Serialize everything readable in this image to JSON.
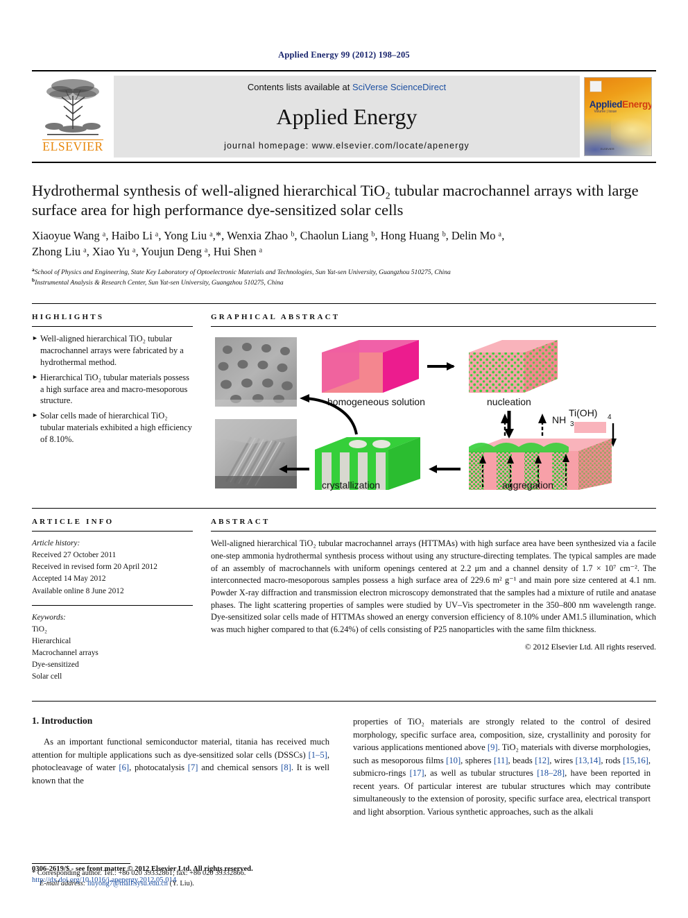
{
  "running_head": "Applied Energy 99 (2012) 198–205",
  "masthead": {
    "publisher": "ELSEVIER",
    "contents_prefix": "Contents lists available at ",
    "contents_link": "SciVerse ScienceDirect",
    "journal_name": "Applied Energy",
    "homepage": "journal homepage: www.elsevier.com/locate/apenergy",
    "cover": {
      "title_a": "Applied",
      "title_b": "Energy",
      "subtitle": "Volume | Issue",
      "footer": "ELSEVIER"
    }
  },
  "article": {
    "title": "Hydrothermal synthesis of well-aligned hierarchical TiO₂ tubular macrochannel arrays with large surface area for high performance dye-sensitized solar cells",
    "authors_line1": "Xiaoyue Wang ᵃ, Haibo Li ᵃ, Yong Liu ᵃ,*, Wenxia Zhao ᵇ, Chaolun Liang ᵇ, Hong Huang ᵇ, Delin Mo ᵃ,",
    "authors_line2": "Zhong Liu ᵃ, Xiao Yu ᵃ, Youjun Deng ᵃ, Hui Shen ᵃ",
    "affiliation_a": "School of Physics and Engineering, State Key Laboratory of Optoelectronic Materials and Technologies, Sun Yat-sen University, Guangzhou 510275, China",
    "affiliation_b": "Instrumental Analysis & Research Center, Sun Yat-sen University, Guangzhou 510275, China"
  },
  "highlights": {
    "heading": "HIGHLIGHTS",
    "items": [
      "Well-aligned hierarchical TiO₂ tubular macrochannel arrays were fabricated by a hydrothermal method.",
      "Hierarchical TiO₂ tubular materials possess a high surface area and macro-mesoporous structure.",
      "Solar cells made of hierarchical TiO₂ tubular materials exhibited a high efficiency of 8.10%."
    ]
  },
  "graphical_abstract": {
    "heading": "GRAPHICAL ABSTRACT",
    "labels": {
      "homogeneous_solution": "homogeneous solution",
      "nucleation": "nucleation",
      "aggregation": "aggregation",
      "crystallization": "crystallization",
      "reagent": "Ti(OH)₄",
      "gas": "NH₃"
    },
    "colors": {
      "magenta": "#ec1c8e",
      "pink": "#f4868f",
      "light_pink": "#f9b3bb",
      "green": "#35cf3a",
      "grey": "#d8d8cf"
    }
  },
  "article_info": {
    "heading": "ARTICLE INFO",
    "history_label": "Article history:",
    "history": [
      "Received 27 October 2011",
      "Received in revised form 20 April 2012",
      "Accepted 14 May 2012",
      "Available online 8 June 2012"
    ],
    "keywords_label": "Keywords:",
    "keywords": [
      "TiO₂",
      "Hierarchical",
      "Macrochannel arrays",
      "Dye-sensitized",
      "Solar cell"
    ]
  },
  "abstract": {
    "heading": "ABSTRACT",
    "text": "Well-aligned hierarchical TiO₂ tubular macrochannel arrays (HTTMAs) with high surface area have been synthesized via a facile one-step ammonia hydrothermal synthesis process without using any structure-directing templates. The typical samples are made of an assembly of macrochannels with uniform openings centered at 2.2 μm and a channel density of 1.7 × 10⁷ cm⁻². The interconnected macro-mesoporous samples possess a high surface area of 229.6 m² g⁻¹ and main pore size centered at 4.1 nm. Powder X-ray diffraction and transmission electron microscopy demonstrated that the samples had a mixture of rutile and anatase phases. The light scattering properties of samples were studied by UV–Vis spectrometer in the 350–800 nm wavelength range. Dye-sensitized solar cells made of HTTMAs showed an energy conversion efficiency of 8.10% under AM1.5 illumination, which was much higher compared to that (6.24%) of cells consisting of P25 nanoparticles with the same film thickness.",
    "copyright": "© 2012 Elsevier Ltd. All rights reserved."
  },
  "introduction": {
    "heading": "1. Introduction",
    "left_paragraph_parts": [
      "As an important functional semiconductor material, titania has received much attention for multiple applications such as dye-sensitized solar cells (DSSCs) ",
      "[1–5]",
      ", photocleavage of water ",
      "[6]",
      ", photocatalysis ",
      "[7]",
      " and chemical sensors ",
      "[8]",
      ". It is well known that the"
    ],
    "right_paragraph_parts": [
      "properties of TiO₂ materials are strongly related to the control of desired morphology, specific surface area, composition, size, crystallinity and porosity for various applications mentioned above ",
      "[9]",
      ". TiO₂ materials with diverse morphologies, such as mesoporous films ",
      "[10]",
      ", spheres ",
      "[11]",
      ", beads ",
      "[12]",
      ", wires ",
      "[13,14]",
      ", rods ",
      "[15,16]",
      ", submicro-rings ",
      "[17]",
      ", as well as tubular structures ",
      "[18–28]",
      ", have been reported in recent years. Of particular interest are tubular structures which may contribute simultaneously to the extension of porosity, specific surface area, electrical transport and light absorption. Various synthetic approaches, such as the alkali"
    ]
  },
  "footnotes": {
    "corresponding_marker": "*",
    "corresponding_text": "Corresponding author. Tel.: +86 020 39332861; fax: +86 020 39332866.",
    "email_label": "E-mail address:",
    "email": "liuyong7@mail.sysu.edu.cn",
    "email_suffix": "(Y. Liu)."
  },
  "page_footer": {
    "front_matter": "0306-2619/$ - see front matter © 2012 Elsevier Ltd. All rights reserved.",
    "doi": "http://dx.doi.org/10.1016/j.apenergy.2012.05.014"
  }
}
